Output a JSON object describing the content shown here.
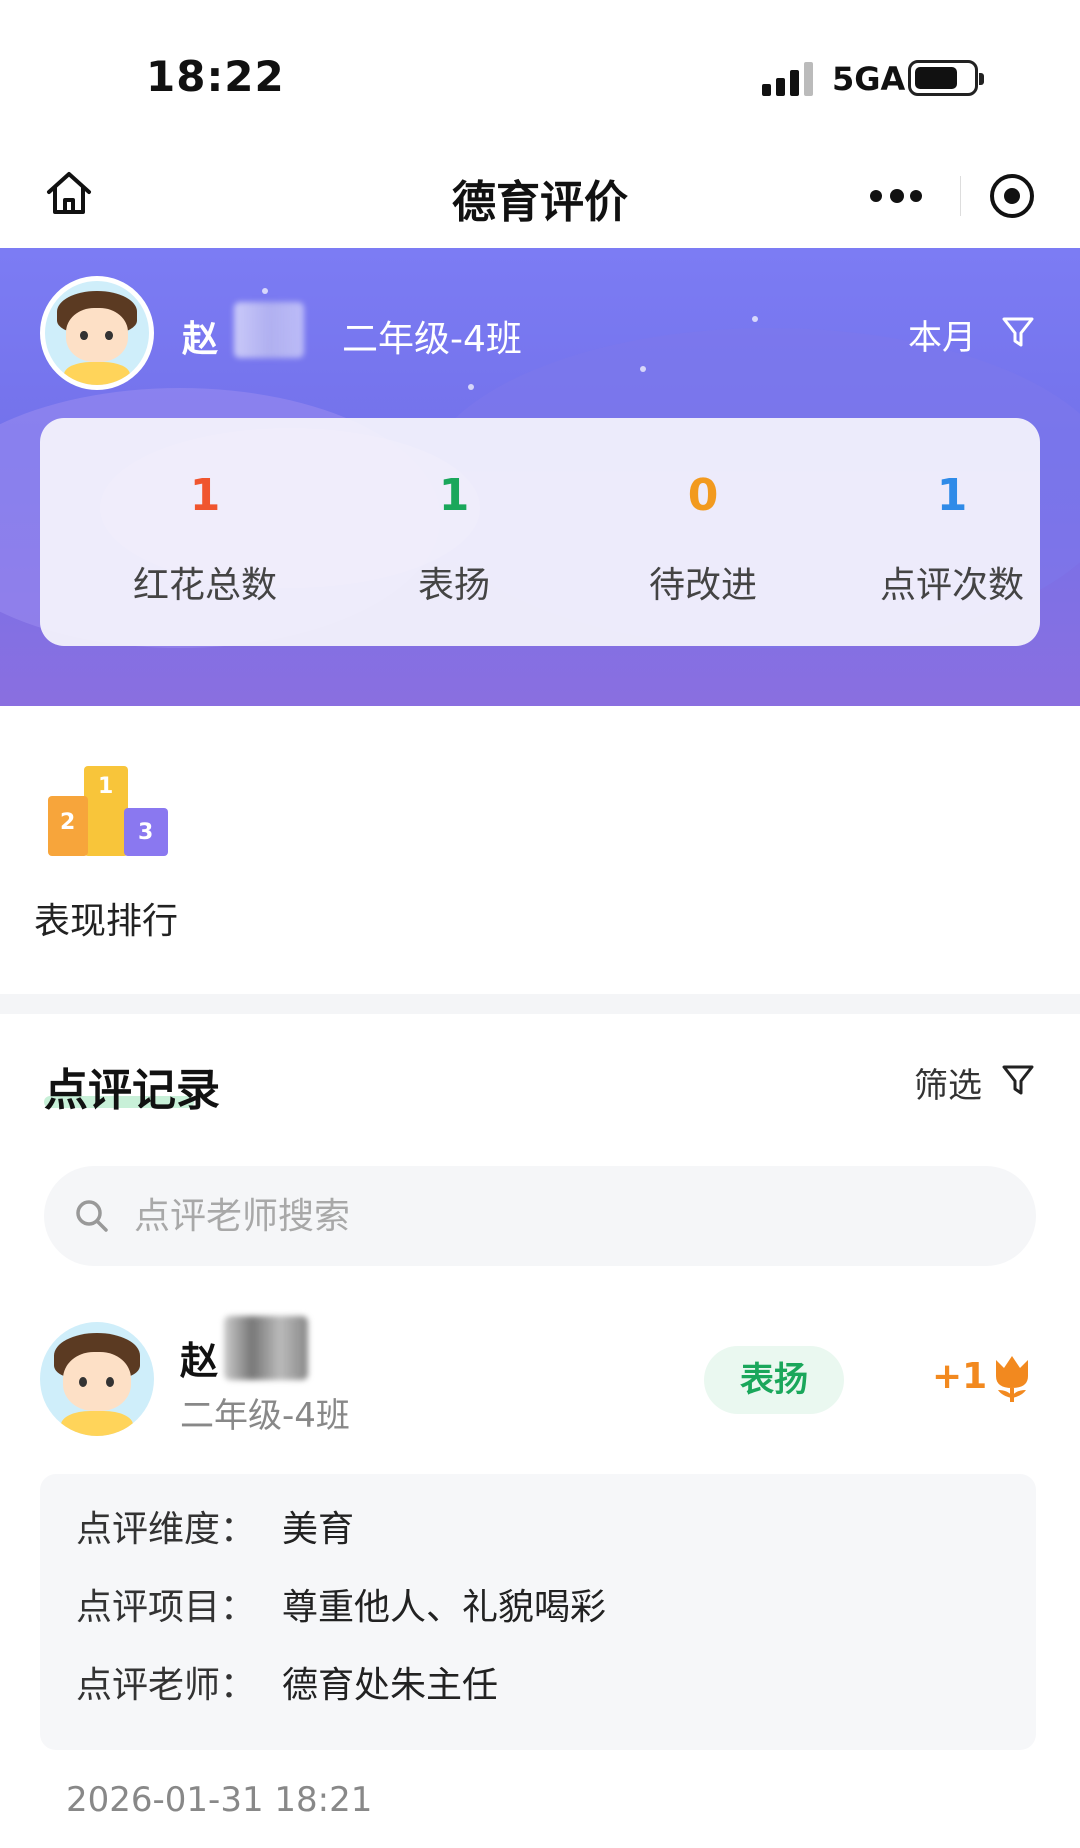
{
  "status_bar": {
    "time": "18:22",
    "network": "5GA"
  },
  "title_bar": {
    "title": "德育评价"
  },
  "header": {
    "surname": "赵",
    "class_name": "二年级-4班",
    "period": "本月"
  },
  "stats": [
    {
      "value": "1",
      "label": "红花总数",
      "color": "#f0552e"
    },
    {
      "value": "1",
      "label": "表扬",
      "color": "#1aa75b"
    },
    {
      "value": "0",
      "label": "待改进",
      "color": "#f29a1f"
    },
    {
      "value": "1",
      "label": "点评次数",
      "color": "#2f8be8"
    }
  ],
  "ranking": {
    "label": "表现排行",
    "podium": [
      "1",
      "2",
      "3"
    ]
  },
  "records": {
    "title": "点评记录",
    "filter_label": "筛选",
    "search_placeholder": "点评老师搜索",
    "items": [
      {
        "surname": "赵",
        "class_name": "二年级-4班",
        "badge": "表扬",
        "points": "+1",
        "details": [
          {
            "key": "点评维度：",
            "value": "美育"
          },
          {
            "key": "点评项目：",
            "value": "尊重他人、礼貌喝彩"
          },
          {
            "key": "点评老师：",
            "value": "德育处朱主任"
          }
        ],
        "time": "2026-01-31 18:21"
      }
    ]
  },
  "icons": {
    "home": "home-icon",
    "more": "more-dots-icon",
    "target": "close-target-icon",
    "filter": "filter-icon",
    "search": "search-icon",
    "flower": "red-flower-icon"
  },
  "colors": {
    "header_gradient_top": "#7c7cf4",
    "header_gradient_bottom": "#8a6fe0",
    "praise_green": "#1aa75b",
    "points_orange": "#f2891f"
  }
}
